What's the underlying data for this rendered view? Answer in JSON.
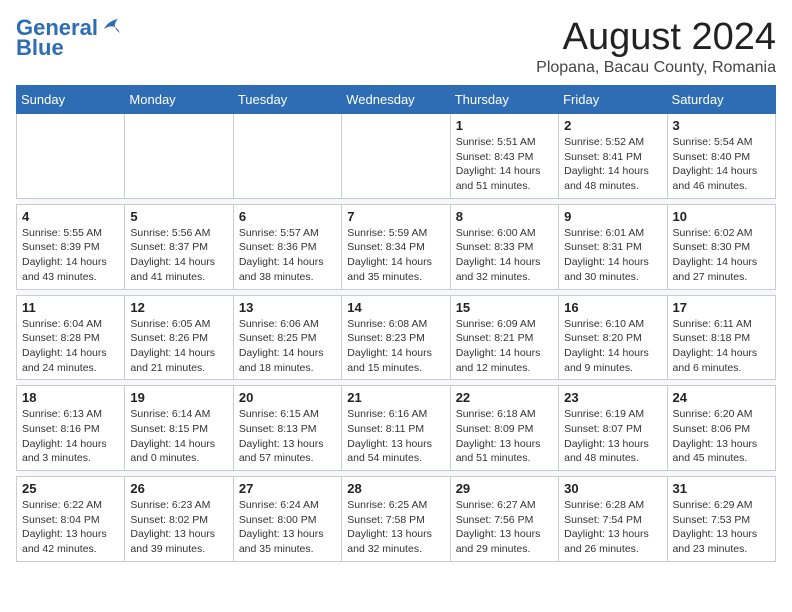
{
  "logo": {
    "line1": "General",
    "line2": "Blue"
  },
  "title": "August 2024",
  "subtitle": "Plopana, Bacau County, Romania",
  "weekdays": [
    "Sunday",
    "Monday",
    "Tuesday",
    "Wednesday",
    "Thursday",
    "Friday",
    "Saturday"
  ],
  "weeks": [
    [
      {
        "day": "",
        "info": ""
      },
      {
        "day": "",
        "info": ""
      },
      {
        "day": "",
        "info": ""
      },
      {
        "day": "",
        "info": ""
      },
      {
        "day": "1",
        "info": "Sunrise: 5:51 AM\nSunset: 8:43 PM\nDaylight: 14 hours\nand 51 minutes."
      },
      {
        "day": "2",
        "info": "Sunrise: 5:52 AM\nSunset: 8:41 PM\nDaylight: 14 hours\nand 48 minutes."
      },
      {
        "day": "3",
        "info": "Sunrise: 5:54 AM\nSunset: 8:40 PM\nDaylight: 14 hours\nand 46 minutes."
      }
    ],
    [
      {
        "day": "4",
        "info": "Sunrise: 5:55 AM\nSunset: 8:39 PM\nDaylight: 14 hours\nand 43 minutes."
      },
      {
        "day": "5",
        "info": "Sunrise: 5:56 AM\nSunset: 8:37 PM\nDaylight: 14 hours\nand 41 minutes."
      },
      {
        "day": "6",
        "info": "Sunrise: 5:57 AM\nSunset: 8:36 PM\nDaylight: 14 hours\nand 38 minutes."
      },
      {
        "day": "7",
        "info": "Sunrise: 5:59 AM\nSunset: 8:34 PM\nDaylight: 14 hours\nand 35 minutes."
      },
      {
        "day": "8",
        "info": "Sunrise: 6:00 AM\nSunset: 8:33 PM\nDaylight: 14 hours\nand 32 minutes."
      },
      {
        "day": "9",
        "info": "Sunrise: 6:01 AM\nSunset: 8:31 PM\nDaylight: 14 hours\nand 30 minutes."
      },
      {
        "day": "10",
        "info": "Sunrise: 6:02 AM\nSunset: 8:30 PM\nDaylight: 14 hours\nand 27 minutes."
      }
    ],
    [
      {
        "day": "11",
        "info": "Sunrise: 6:04 AM\nSunset: 8:28 PM\nDaylight: 14 hours\nand 24 minutes."
      },
      {
        "day": "12",
        "info": "Sunrise: 6:05 AM\nSunset: 8:26 PM\nDaylight: 14 hours\nand 21 minutes."
      },
      {
        "day": "13",
        "info": "Sunrise: 6:06 AM\nSunset: 8:25 PM\nDaylight: 14 hours\nand 18 minutes."
      },
      {
        "day": "14",
        "info": "Sunrise: 6:08 AM\nSunset: 8:23 PM\nDaylight: 14 hours\nand 15 minutes."
      },
      {
        "day": "15",
        "info": "Sunrise: 6:09 AM\nSunset: 8:21 PM\nDaylight: 14 hours\nand 12 minutes."
      },
      {
        "day": "16",
        "info": "Sunrise: 6:10 AM\nSunset: 8:20 PM\nDaylight: 14 hours\nand 9 minutes."
      },
      {
        "day": "17",
        "info": "Sunrise: 6:11 AM\nSunset: 8:18 PM\nDaylight: 14 hours\nand 6 minutes."
      }
    ],
    [
      {
        "day": "18",
        "info": "Sunrise: 6:13 AM\nSunset: 8:16 PM\nDaylight: 14 hours\nand 3 minutes."
      },
      {
        "day": "19",
        "info": "Sunrise: 6:14 AM\nSunset: 8:15 PM\nDaylight: 14 hours\nand 0 minutes."
      },
      {
        "day": "20",
        "info": "Sunrise: 6:15 AM\nSunset: 8:13 PM\nDaylight: 13 hours\nand 57 minutes."
      },
      {
        "day": "21",
        "info": "Sunrise: 6:16 AM\nSunset: 8:11 PM\nDaylight: 13 hours\nand 54 minutes."
      },
      {
        "day": "22",
        "info": "Sunrise: 6:18 AM\nSunset: 8:09 PM\nDaylight: 13 hours\nand 51 minutes."
      },
      {
        "day": "23",
        "info": "Sunrise: 6:19 AM\nSunset: 8:07 PM\nDaylight: 13 hours\nand 48 minutes."
      },
      {
        "day": "24",
        "info": "Sunrise: 6:20 AM\nSunset: 8:06 PM\nDaylight: 13 hours\nand 45 minutes."
      }
    ],
    [
      {
        "day": "25",
        "info": "Sunrise: 6:22 AM\nSunset: 8:04 PM\nDaylight: 13 hours\nand 42 minutes."
      },
      {
        "day": "26",
        "info": "Sunrise: 6:23 AM\nSunset: 8:02 PM\nDaylight: 13 hours\nand 39 minutes."
      },
      {
        "day": "27",
        "info": "Sunrise: 6:24 AM\nSunset: 8:00 PM\nDaylight: 13 hours\nand 35 minutes."
      },
      {
        "day": "28",
        "info": "Sunrise: 6:25 AM\nSunset: 7:58 PM\nDaylight: 13 hours\nand 32 minutes."
      },
      {
        "day": "29",
        "info": "Sunrise: 6:27 AM\nSunset: 7:56 PM\nDaylight: 13 hours\nand 29 minutes."
      },
      {
        "day": "30",
        "info": "Sunrise: 6:28 AM\nSunset: 7:54 PM\nDaylight: 13 hours\nand 26 minutes."
      },
      {
        "day": "31",
        "info": "Sunrise: 6:29 AM\nSunset: 7:53 PM\nDaylight: 13 hours\nand 23 minutes."
      }
    ]
  ]
}
